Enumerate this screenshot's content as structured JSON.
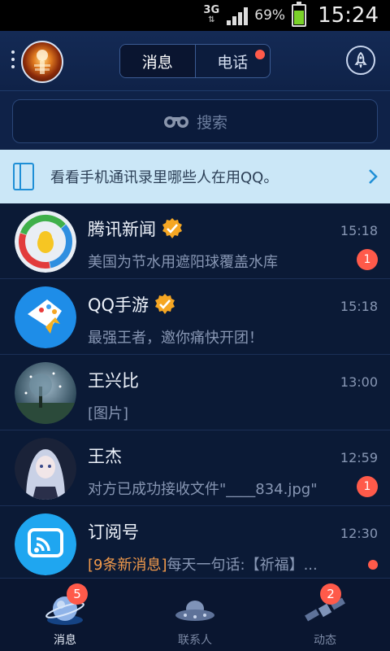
{
  "status_bar": {
    "network": "3G",
    "battery_percent": "69%",
    "battery_level": 0.69,
    "time": "15:24"
  },
  "header": {
    "tabs": [
      {
        "label": "消息",
        "active": true
      },
      {
        "label": "电话",
        "active": false,
        "has_dot": true
      }
    ]
  },
  "search": {
    "placeholder": "搜索"
  },
  "banner": {
    "text": "看看手机通讯录里哪些人在用QQ。"
  },
  "conversations": [
    {
      "name": "腾讯新闻",
      "verified": true,
      "time": "15:18",
      "message": "美国为节水用遮阳球覆盖水库",
      "badge": "1"
    },
    {
      "name": "QQ手游",
      "verified": true,
      "time": "15:18",
      "message": "最强王者，邀你痛快开团！",
      "badge": null
    },
    {
      "name": "王兴比",
      "verified": false,
      "time": "13:00",
      "message": "[图片]",
      "badge": null
    },
    {
      "name": "王杰",
      "verified": false,
      "time": "12:59",
      "message": "对方已成功接收文件\"____834.jpg\"",
      "badge": "1"
    },
    {
      "name": "订阅号",
      "verified": false,
      "time": "12:30",
      "message_highlight": "[9条新消息]",
      "message": "每天一句话:【祈福】...",
      "dot": true
    }
  ],
  "bottom_nav": [
    {
      "label": "消息",
      "badge": "5",
      "active": true
    },
    {
      "label": "联系人",
      "badge": null,
      "active": false
    },
    {
      "label": "动态",
      "badge": "2",
      "active": false
    }
  ],
  "colors": {
    "background": "#0b1a36",
    "badge": "#ff5a4a",
    "highlight": "#f29a4b",
    "banner": "#cbe7f7",
    "accent": "#1f8fd6"
  }
}
